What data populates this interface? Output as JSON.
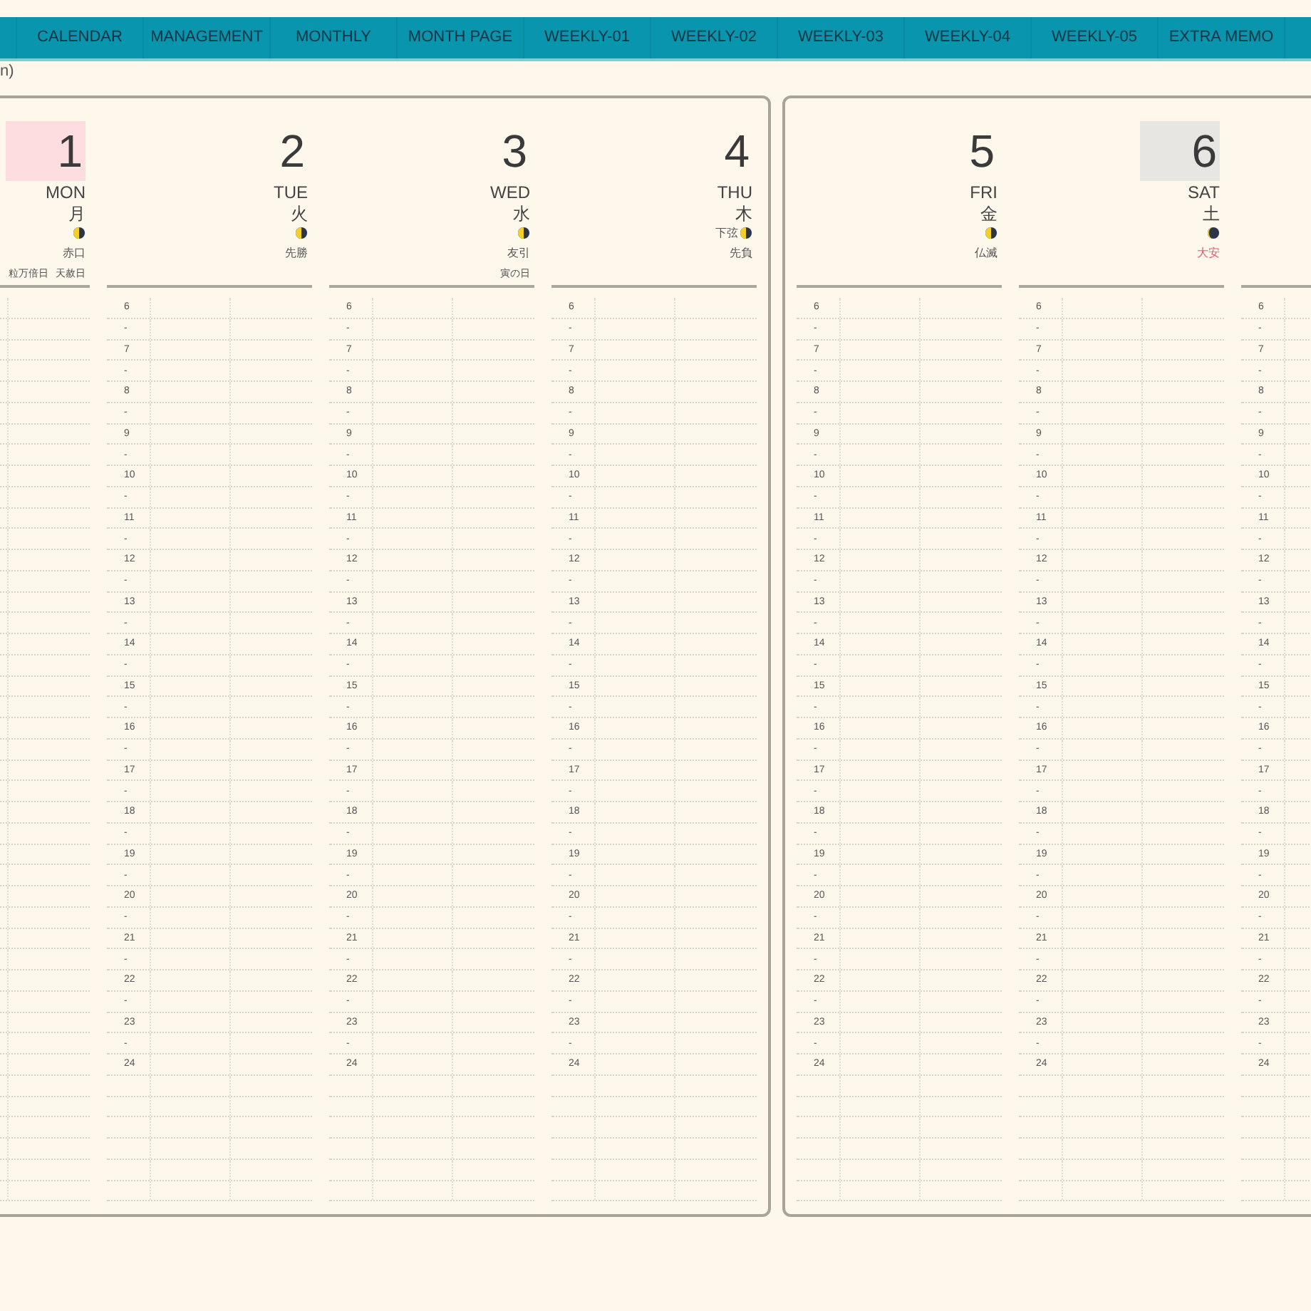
{
  "nav": [
    {
      "label": "CALENDAR"
    },
    {
      "label": "MANAGEMENT"
    },
    {
      "label": "MONTHLY"
    },
    {
      "label": "MONTH PAGE"
    },
    {
      "label": "WEEKLY-01"
    },
    {
      "label": "WEEKLY-02"
    },
    {
      "label": "WEEKLY-03"
    },
    {
      "label": "WEEKLY-04"
    },
    {
      "label": "WEEKLY-05"
    },
    {
      "label": "EXTRA MEMO"
    }
  ],
  "corner_text": "n)",
  "pages": [
    {
      "days": [
        {
          "date": "1",
          "weekday": "MON",
          "kanji": "月",
          "holiday": true,
          "saturday": false,
          "new_moon": false,
          "rokuyo": "赤口",
          "rokuyo_red": false,
          "notes": [
            "粒万倍日",
            "天赦日"
          ]
        },
        {
          "date": "2",
          "weekday": "TUE",
          "kanji": "火",
          "holiday": false,
          "saturday": false,
          "new_moon": false,
          "rokuyo": "先勝",
          "rokuyo_red": false,
          "hours": [
            "6",
            "-",
            "7",
            "-",
            "8",
            "-",
            "9",
            "-",
            "10",
            "-",
            "11",
            "-",
            "12",
            "-",
            "13",
            "-",
            "14",
            "-",
            "15",
            "-",
            "16",
            "-",
            "17",
            "-",
            "18",
            "-",
            "19",
            "-",
            "20",
            "-",
            "21",
            "-",
            "22",
            "-",
            "23",
            "-",
            "24"
          ]
        },
        {
          "date": "3",
          "weekday": "WED",
          "kanji": "水",
          "holiday": false,
          "saturday": false,
          "new_moon": false,
          "rokuyo": "友引",
          "rokuyo_red": false,
          "notes": [
            "寅の日"
          ],
          "hours": [
            "6",
            "-",
            "7",
            "-",
            "8",
            "-",
            "9",
            "-",
            "10",
            "-",
            "11",
            "-",
            "12",
            "-",
            "13",
            "-",
            "14",
            "-",
            "15",
            "-",
            "16",
            "-",
            "17",
            "-",
            "18",
            "-",
            "19",
            "-",
            "20",
            "-",
            "21",
            "-",
            "22",
            "-",
            "23",
            "-",
            "24"
          ]
        },
        {
          "date": "4",
          "weekday": "THU",
          "kanji": "木",
          "holiday": false,
          "saturday": false,
          "new_moon": false,
          "moon_label": "下弦",
          "rokuyo": "先負",
          "rokuyo_red": false,
          "hours": [
            "6",
            "-",
            "7",
            "-",
            "8",
            "-",
            "9",
            "-",
            "10",
            "-",
            "11",
            "-",
            "12",
            "-",
            "13",
            "-",
            "14",
            "-",
            "15",
            "-",
            "16",
            "-",
            "17",
            "-",
            "18",
            "-",
            "19",
            "-",
            "20",
            "-",
            "21",
            "-",
            "22",
            "-",
            "23",
            "-",
            "24"
          ]
        }
      ]
    },
    {
      "days": [
        {
          "date": "5",
          "weekday": "FRI",
          "kanji": "金",
          "holiday": false,
          "saturday": false,
          "new_moon": false,
          "rokuyo": "仏滅",
          "rokuyo_red": false,
          "hours": [
            "6",
            "-",
            "7",
            "-",
            "8",
            "-",
            "9",
            "-",
            "10",
            "-",
            "11",
            "-",
            "12",
            "-",
            "13",
            "-",
            "14",
            "-",
            "15",
            "-",
            "16",
            "-",
            "17",
            "-",
            "18",
            "-",
            "19",
            "-",
            "20",
            "-",
            "21",
            "-",
            "22",
            "-",
            "23",
            "-",
            "24"
          ]
        },
        {
          "date": "6",
          "weekday": "SAT",
          "kanji": "土",
          "holiday": false,
          "saturday": true,
          "new_moon": true,
          "rokuyo": "大安",
          "rokuyo_red": true,
          "hours": [
            "6",
            "-",
            "7",
            "-",
            "8",
            "-",
            "9",
            "-",
            "10",
            "-",
            "11",
            "-",
            "12",
            "-",
            "13",
            "-",
            "14",
            "-",
            "15",
            "-",
            "16",
            "-",
            "17",
            "-",
            "18",
            "-",
            "19",
            "-",
            "20",
            "-",
            "21",
            "-",
            "22",
            "-",
            "23",
            "-",
            "24"
          ]
        },
        {
          "hours": [
            "6",
            "-",
            "7",
            "-",
            "8",
            "-",
            "9",
            "-",
            "10",
            "-",
            "11",
            "-",
            "12",
            "-",
            "13",
            "-",
            "14",
            "-",
            "15",
            "-",
            "16",
            "-",
            "17",
            "-",
            "18",
            "-",
            "19",
            "-",
            "20",
            "-",
            "21",
            "-",
            "22",
            "-",
            "23",
            "-",
            "24"
          ]
        }
      ]
    }
  ]
}
